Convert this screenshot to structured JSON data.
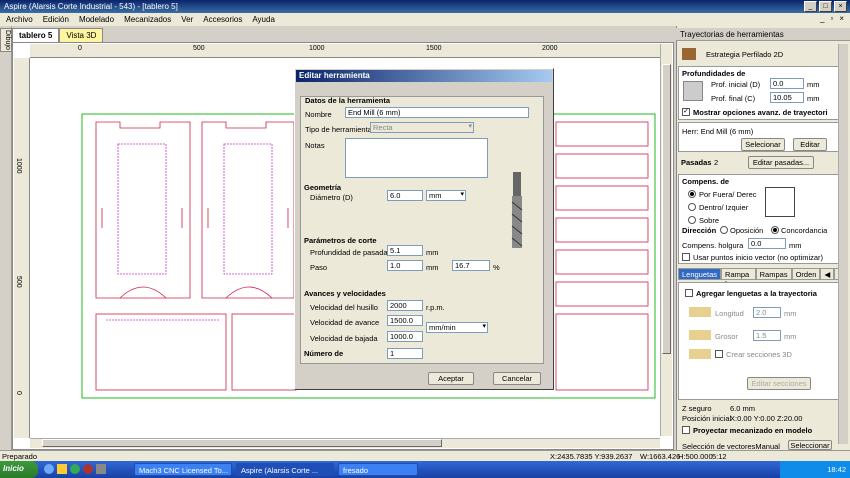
{
  "window": {
    "title": "Aspire (Alarsis Corte Industrial - 543) - [tablero 5]"
  },
  "menu": {
    "items": [
      "Archivo",
      "Edición",
      "Modelado",
      "Mecanizados",
      "Ver",
      "Accesorios",
      "Ayuda"
    ]
  },
  "left_tabs": {
    "tab1": "Dibujo"
  },
  "doc_tabs": {
    "tab1": "tablero 5",
    "tab2": "Vista 3D"
  },
  "rulers": {
    "h": [
      "0",
      "500",
      "1000",
      "1500",
      "2000"
    ],
    "v": [
      "1000",
      "500",
      "0"
    ]
  },
  "panel": {
    "title": "Trayectorias de herramientas",
    "strategy": "Estrategia Perfilado 2D",
    "depths_heading": "Profundidades de",
    "start_depth_label": "Prof. inicial (D)",
    "start_depth_value": "0.0",
    "end_depth_label": "Prof. final (C)",
    "end_depth_value": "10.05",
    "unit": "mm",
    "show_advanced": "Mostrar opciones avanz. de trayectori",
    "tool_label": "Herr: End Mill (6 mm)",
    "select_button": "Selecionar",
    "edit_button": "Editar",
    "passes_label": "Pasadas",
    "passes_value": "2",
    "edit_passes_button": "Editar pasadas...",
    "comp_heading": "Compens. de",
    "comp_outside": "Por Fuera/ Derec",
    "comp_inside": "Dentro/ Izquier",
    "comp_on": "Sobre",
    "direction_label": "Dirección",
    "direction_opposition": "Oposición",
    "direction_concordance": "Concordancia",
    "allowance_label": "Compens. holgura",
    "allowance_value": "0.0",
    "start_points": "Usar puntos inicio vector (no optimizar)",
    "tabs": [
      "Lenguetas",
      "Rampa L...",
      "Rampas",
      "Orden"
    ],
    "add_tabs": "Agregar lenguetas a la trayectoria",
    "length_label": "Longitud",
    "length_value": "2.0",
    "thickness_label": "Grosor",
    "thickness_value": "1.5",
    "create_3d": "Crear secciones 3D",
    "edit_sections_button": "Editar secciones",
    "safe_z_label": "Z seguro",
    "safe_z_value": "6.0 mm",
    "home_label": "Posición inicial",
    "home_value": "X:0.00 Y:0.00 Z:20.00",
    "project_label": "Proyectar mecanizado en modelo",
    "vector_selection_label": "Selección de vectoresManual",
    "vector_selection_button": "Seleccionar"
  },
  "dialog": {
    "title": "Editar herramienta",
    "tool_data_heading": "Datos de la herramienta",
    "name_label": "Nombre",
    "name_value": "End Mill (6 mm)",
    "type_label": "Tipo de herramienta",
    "type_value": "Recta",
    "notes_label": "Notas",
    "geometry_heading": "Geometría",
    "diameter_label": "Diámetro (D)",
    "diameter_value": "6.0",
    "diameter_unit": "mm",
    "cut_params_heading": "Parámetros de corte",
    "pass_depth_label": "Profundidad de pasada",
    "pass_depth_value": "5.1",
    "pass_depth_unit": "mm",
    "stepover_label": "Paso",
    "stepover_value": "1.0",
    "stepover_unit": "mm",
    "stepover_pct_value": "16.7",
    "stepover_pct_unit": "%",
    "feeds_heading": "Avances y velocidades",
    "spindle_label": "Velocidad del husillo",
    "spindle_value": "2000",
    "spindle_unit": "r.p.m.",
    "feed_label": "Velocidad de avance",
    "feed_value": "1500.0",
    "feed_unit": "mm/min",
    "plunge_label": "Velocidad de bajada",
    "plunge_value": "1000.0",
    "number_label": "Número de",
    "number_value": "1",
    "ok_button": "Aceptar",
    "cancel_button": "Cancelar"
  },
  "status": {
    "left": "Preparado",
    "coords": "X:2435.7835 Y:939.2637",
    "w": "W:1663.426",
    "h": "H:500.000",
    "extra": "5:12"
  },
  "taskbar": {
    "start": "Inicio",
    "item1": "Mach3 CNC Licensed To...",
    "item2": "Aspire (Alarsis Corte ...",
    "item3": "fresado",
    "clock": "18:42"
  },
  "colors": {
    "cut_lines": "#cc2244",
    "pocket_lines": "#cc33cc",
    "sheet_border": "#22bb22",
    "title_blue": "#0a246a"
  }
}
